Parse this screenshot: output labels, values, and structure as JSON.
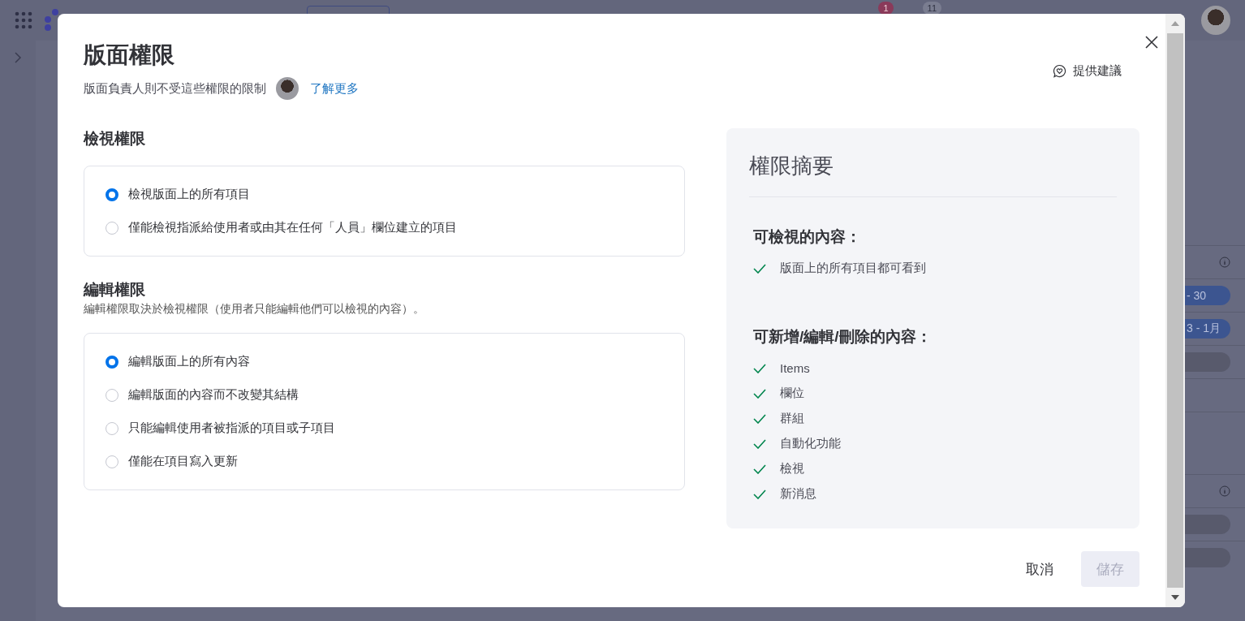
{
  "background": {
    "notification_count": "1",
    "updates_count": "11",
    "right_rows": [
      {
        "kind": "header"
      },
      {
        "kind": "date-pill",
        "text": "- 30"
      },
      {
        "kind": "date-pill",
        "text": "3 - 1月"
      },
      {
        "kind": "empty-pill"
      },
      {
        "kind": "blank"
      },
      {
        "kind": "blank"
      },
      {
        "kind": "gap"
      },
      {
        "kind": "header"
      },
      {
        "kind": "empty-pill"
      },
      {
        "kind": "empty-pill"
      }
    ]
  },
  "dialog": {
    "title": "版面權限",
    "subtitle": "版面負責人則不受這些權限的限制",
    "learn_more": "了解更多",
    "feedback": "提供建議",
    "view_section": {
      "title": "檢視權限",
      "options": [
        {
          "label": "檢視版面上的所有項目",
          "selected": true
        },
        {
          "label": "僅能檢視指派給使用者或由其在任何「人員」欄位建立的項目",
          "selected": false
        }
      ]
    },
    "edit_section": {
      "title": "編輯權限",
      "description": "編輯權限取決於檢視權限（使用者只能編輯他們可以檢視的內容）。",
      "options": [
        {
          "label": "編輯版面上的所有內容",
          "selected": true
        },
        {
          "label": "編輯版面的內容而不改變其結構",
          "selected": false
        },
        {
          "label": "只能編輯使用者被指派的項目或子項目",
          "selected": false
        },
        {
          "label": "僅能在項目寫入更新",
          "selected": false
        }
      ]
    },
    "summary": {
      "title": "權限摘要",
      "groups": [
        {
          "heading": "可檢視的內容：",
          "items": [
            "版面上的所有項目都可看到"
          ]
        },
        {
          "heading": "可新增/編輯/刪除的內容：",
          "items": [
            "Items",
            "欄位",
            "群組",
            "自動化功能",
            "檢視",
            "新消息"
          ]
        }
      ]
    },
    "cancel": "取消",
    "save": {
      "label": "儲存",
      "disabled": true
    }
  }
}
